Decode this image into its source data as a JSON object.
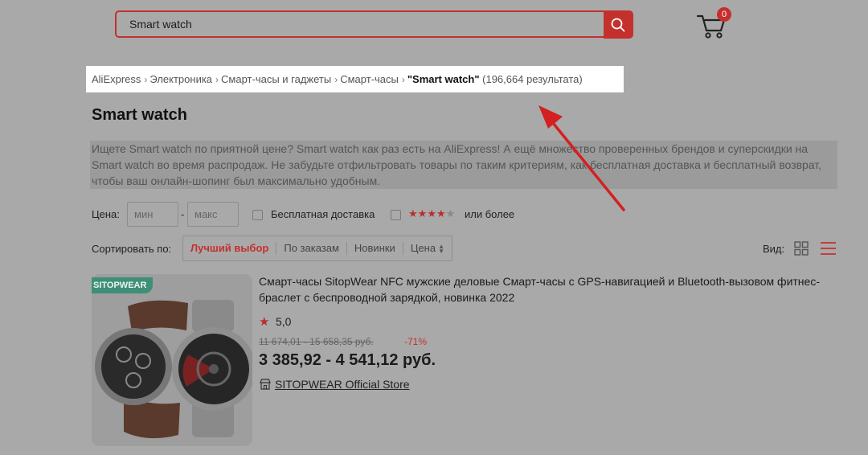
{
  "search": {
    "query": "Smart watch"
  },
  "cart": {
    "count": "0"
  },
  "breadcrumb": {
    "items": [
      "AliExpress",
      "Электроника",
      "Смарт-часы и гаджеты",
      "Смарт-часы"
    ],
    "current": "\"Smart watch\"",
    "result_count": "(196,664 результата)"
  },
  "page": {
    "title": "Smart watch",
    "description": "Ищете Smart watch по приятной цене? Smart watch как раз есть на AliExpress! А ещё множество проверенных брендов и суперскидки на Smart watch во время распродаж. Не забудьте отфильтровать товары по таким критериям, как бесплатная доставка и бесплатный возврат, чтобы ваш онлайн-шопинг был максимально удобным."
  },
  "filters": {
    "price_label": "Цена:",
    "min_placeholder": "мин",
    "dash": "-",
    "max_placeholder": "макс",
    "free_shipping_label": "Бесплатная доставка",
    "rating_stars_filled": 4,
    "rating_stars_total": 5,
    "rating_label": "или более"
  },
  "sort": {
    "label": "Сортировать по:",
    "options": [
      "Лучший выбор",
      "По заказам",
      "Новинки",
      "Цена"
    ],
    "active_index": 0
  },
  "view": {
    "label": "Вид:"
  },
  "product": {
    "brand_badge": "SITOPWEAR",
    "title": "Смарт-часы SitopWear NFC мужские деловые Смарт-часы с GPS-навигацией и Bluetooth-вызовом фитнес-браслет с беспроводной зарядкой, новинка 2022",
    "rating": "5,0",
    "old_price": "11 674,01 - 15 658,35 руб.",
    "discount": "-71%",
    "price": "3 385,92 - 4 541,12 руб.",
    "store": "SITOPWEAR Official Store"
  },
  "colors": {
    "accent": "#c4302c",
    "overlay_gray": "#a9a9a9",
    "badge_green": "#3f8f78"
  }
}
